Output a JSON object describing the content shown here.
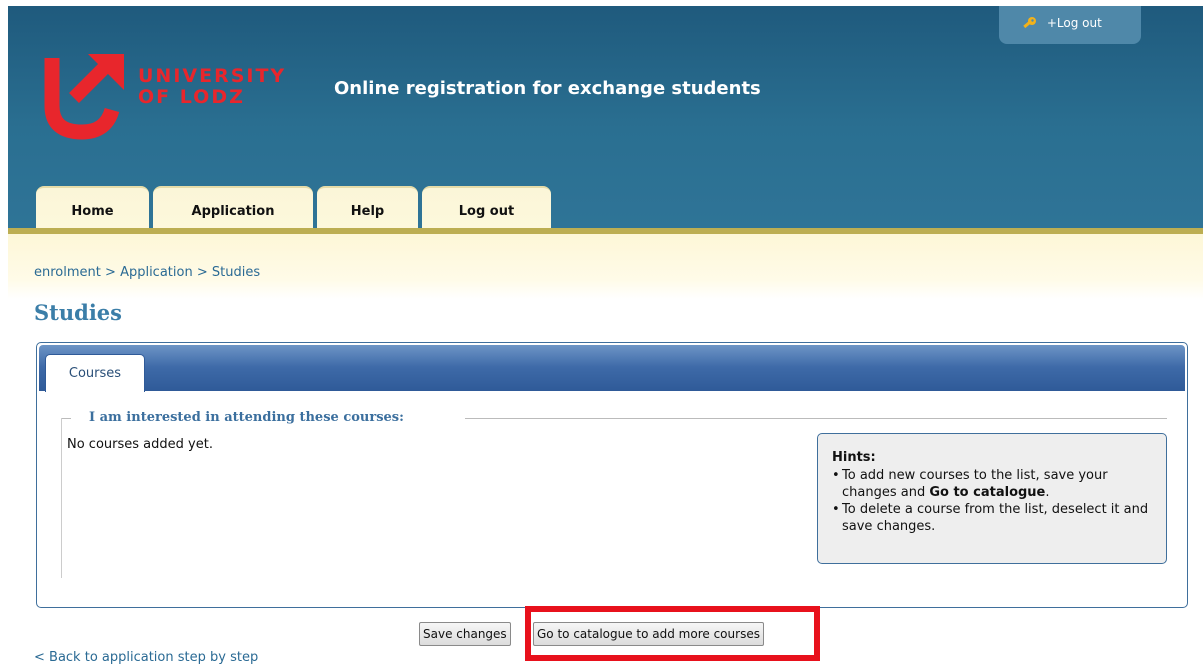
{
  "header": {
    "logo_lines": [
      "UNIVERSITY",
      "OF LODZ"
    ],
    "title": "Online registration for exchange students",
    "top_link": "+Log out",
    "top_link_icon": "key-icon"
  },
  "nav": {
    "tabs": [
      {
        "label": "Home"
      },
      {
        "label": "Application"
      },
      {
        "label": "Help"
      },
      {
        "label": "Log out"
      }
    ]
  },
  "breadcrumb": {
    "items": [
      "enrolment",
      "Application",
      "Studies"
    ],
    "separator": ">"
  },
  "page": {
    "title": "Studies"
  },
  "panel": {
    "tab_label": "Courses",
    "legend": "I am interested in attending these courses:",
    "empty_message": "No courses added yet."
  },
  "hints": {
    "heading": "Hints:",
    "items": [
      {
        "text_before": "To add new courses to the list, save your changes and ",
        "bold": "Go to catalogue",
        "text_after": "."
      },
      {
        "text_before": "To delete a course from the list, deselect it and save changes.",
        "bold": "",
        "text_after": ""
      }
    ]
  },
  "actions": {
    "save_label": "Save changes",
    "catalogue_label": "Go to catalogue to add more courses"
  },
  "footer": {
    "back_link": "< Back to application step by step"
  },
  "colors": {
    "header_blue": "#2a6f91",
    "brand_red": "#e8262c",
    "link_blue": "#2a6a94",
    "highlight_red": "#e8111c"
  }
}
